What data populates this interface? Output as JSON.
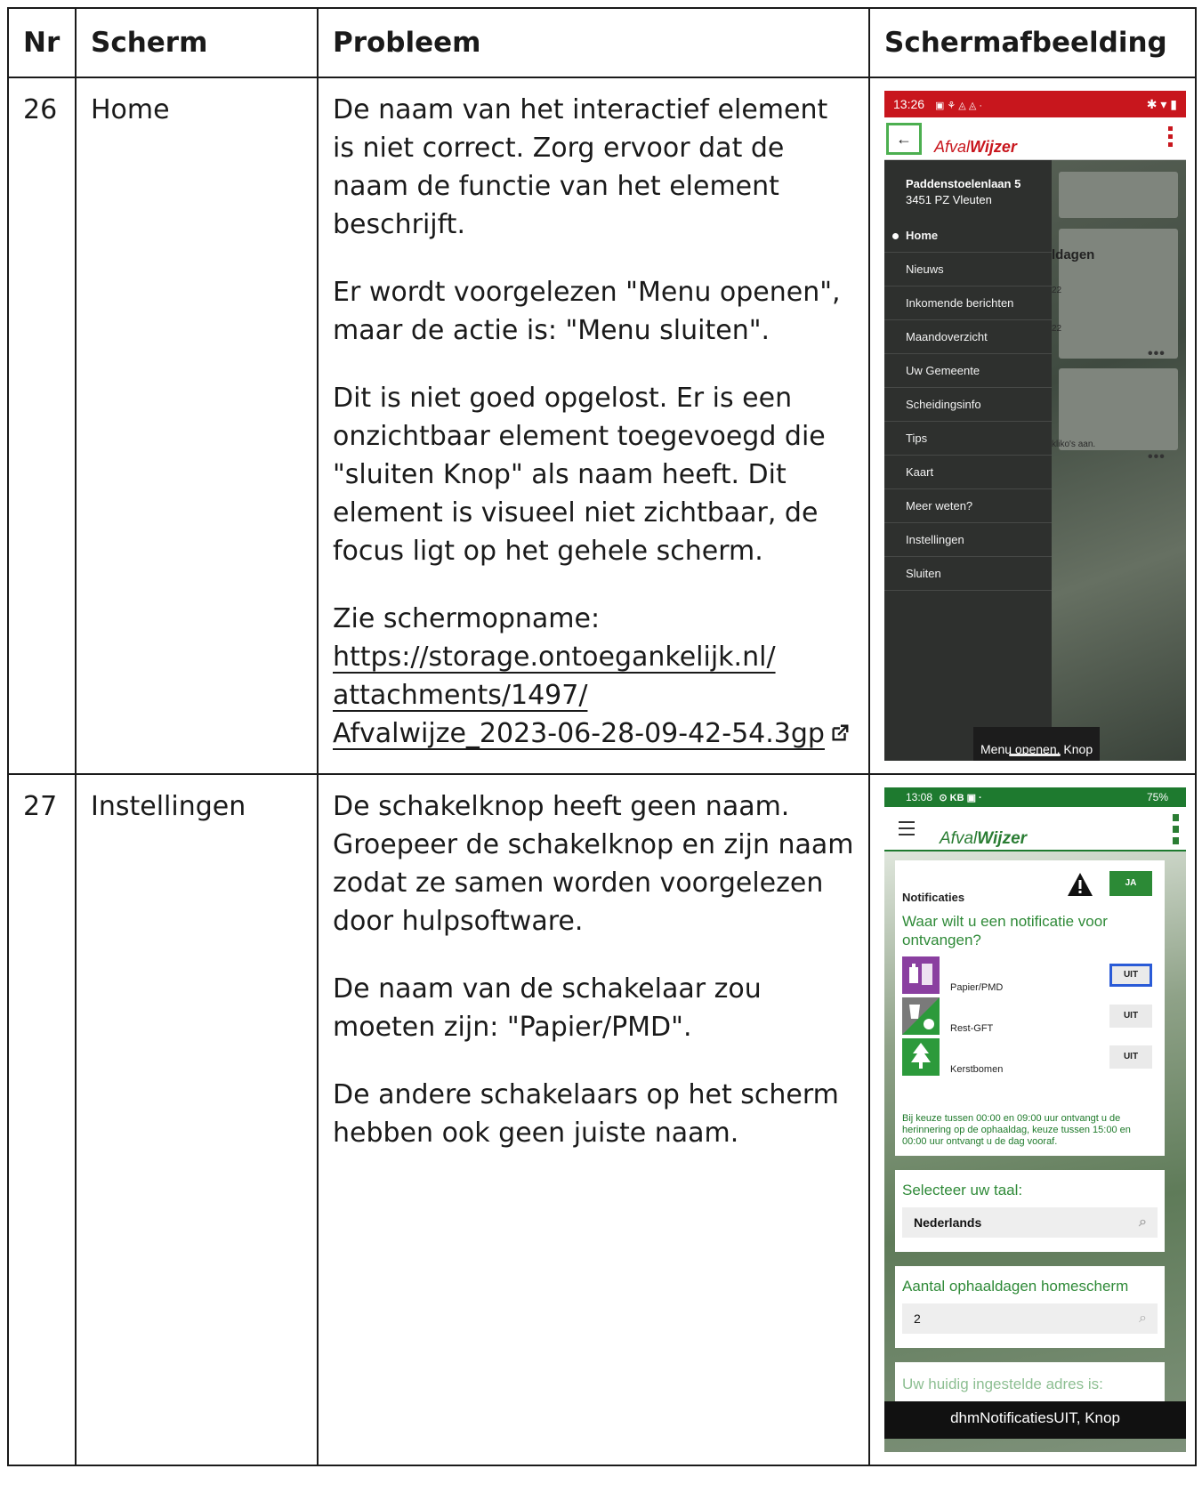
{
  "table": {
    "headers": [
      "Nr",
      "Scherm",
      "Probleem",
      "Schermafbeelding"
    ]
  },
  "rows": [
    {
      "nr": "26",
      "scherm": "Home",
      "probleem": [
        "De naam van het interactief element is niet correct. Zorg ervoor dat de naam de functie van het element beschrijft.",
        "Er wordt voorgelezen \"Menu openen\", maar de actie is: \"Menu sluiten\".",
        "Dit is niet goed opgelost. Er is een onzichtbaar element toegevoegd die \"sluiten Knop\" als naam heeft. Dit element is visueel niet zichtbaar, de focus ligt op het gehele scherm.",
        "Zie schermopname:"
      ],
      "link": "https://storage.ontoegankelijk.nl/attachments/1497/Afvalwijze_2023-06-28-09-42-54.3gp",
      "link_lines": [
        "https://storage.ontoegankelijk.nl/",
        "attachments/1497/",
        "Afvalwijze_2023-06-28-09-42-54.3gp"
      ],
      "screenshot": {
        "status_time": "13:26",
        "status_icons_left": "▣ ⚘ ◬ ◬ ·",
        "status_icons_right": "✱ ▾ ▮",
        "logo_light": "Afval",
        "logo_bold": "Wijzer",
        "address_line1": "Paddenstoelenlaan 5",
        "address_line2": "3451 PZ Vleuten",
        "menu": [
          "Home",
          "Nieuws",
          "Inkomende berichten",
          "Maandoverzicht",
          "Uw Gemeente",
          "Scheidingsinfo",
          "Tips",
          "Kaart",
          "Meer weten?",
          "Instellingen",
          "Sluiten"
        ],
        "bg_title": "ldagen",
        "bg_small1": "22",
        "bg_small2": "22",
        "bg_small3": "kliko's aan.",
        "dots": "•••",
        "toast": "Menu openen, Knop",
        "accent_color": "#c8161d",
        "focus_color": "#4caf50"
      }
    },
    {
      "nr": "27",
      "scherm": "Instellingen",
      "probleem": [
        "De schakelknop heeft geen naam. Groepeer de schakelknop en zijn naam zodat ze samen worden voorgelezen door hulpsoftware.",
        "De naam van de schakelaar zou moeten zijn: \"Papier/PMD\".",
        "De andere schakelaars op het scherm hebben ook geen juiste naam."
      ],
      "screenshot": {
        "status_time": "13:08",
        "status_icons_left": "⊙ KB ▣ ·",
        "status_right": "75%",
        "logo_light": "Afval",
        "logo_bold": "Wijzer",
        "notificaties_label": "Notificaties",
        "ja_label": "JA",
        "question": "Waar wilt u een notificatie voor ontvangen?",
        "toggles": [
          {
            "label": "Papier/PMD",
            "value": "UIT",
            "icon": "papier-pmd-icon",
            "color": "#8a3fa0"
          },
          {
            "label": "Rest-GFT",
            "value": "UIT",
            "icon": "rest-gft-icon",
            "color": "#7a7a7a"
          },
          {
            "label": "Kerstbomen",
            "value": "UIT",
            "icon": "kerstboom-icon",
            "color": "#2c9a3b"
          }
        ],
        "note": "Bij keuze tussen 00:00 en 09:00 uur ontvangt u de herinnering op de ophaaldag, keuze tussen 15:00 en 00:00 uur ontvangt u de dag vooraf.",
        "taal_label": "Selecteer uw taal:",
        "taal_value": "Nederlands",
        "aantal_label": "Aantal ophaaldagen homescherm",
        "aantal_value": "2",
        "adres_label": "Uw huidig ingestelde adres is:",
        "toast": "dhmNotificatiesUIT, Knop",
        "focus_color": "#2a5bd7",
        "accent_color": "#1e7a2f"
      }
    }
  ]
}
